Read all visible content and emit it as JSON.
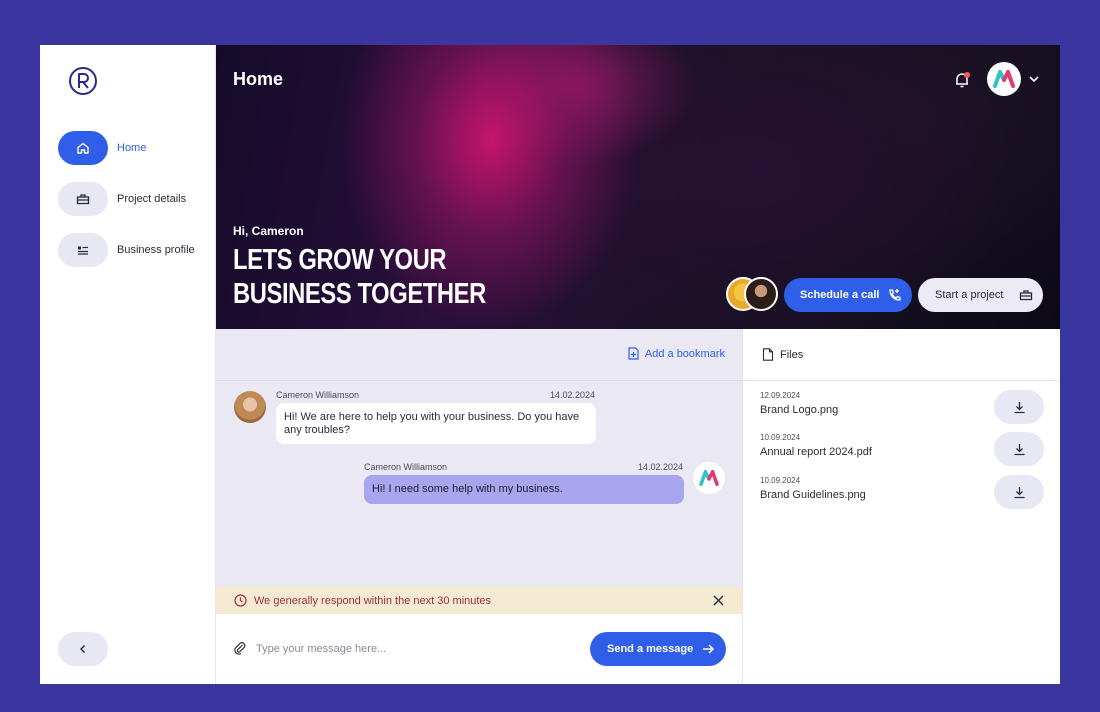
{
  "colors": {
    "accent": "#2f5fe8",
    "page_background": "#3b35a0",
    "outgoing_bubble": "#a9a5ef",
    "notice_background": "#f5ead2",
    "notice_text": "#a0303a"
  },
  "sidebar": {
    "logo_icon": "r-circle-logo-icon",
    "items": [
      {
        "label": "Home",
        "icon": "home-icon",
        "active": true
      },
      {
        "label": "Project details",
        "icon": "briefcase-icon",
        "active": false
      },
      {
        "label": "Business profile",
        "icon": "profile-card-icon",
        "active": false
      }
    ],
    "collapse_icon": "chevron-left-icon"
  },
  "header": {
    "title": "Home",
    "notification_icon": "bell-icon",
    "avatar_icon": "m-logo-icon"
  },
  "hero": {
    "greeting": "Hi, Cameron",
    "headline_line1": "LETS GROW YOUR",
    "headline_line2": "BUSINESS TOGETHER",
    "schedule_call_label": "Schedule a call",
    "start_project_label": "Start a project"
  },
  "chat": {
    "bookmark_label": "Add a bookmark",
    "messages": [
      {
        "author": "Cameron Williamson",
        "date": "14.02.2024",
        "text": "Hi!  We are here to help you with your business. Do you have any troubles?",
        "direction": "incoming"
      },
      {
        "author": "Cameron Williamson",
        "date": "14.02.2024",
        "text": "Hi!  I need some help with my business.",
        "direction": "outgoing"
      }
    ],
    "notice": "We generally respond within the next 30 minutes",
    "input_placeholder": "Type your message here...",
    "send_label": "Send a message"
  },
  "files": {
    "title": "Files",
    "items": [
      {
        "date": "12.09.2024",
        "name": "Brand Logo.png"
      },
      {
        "date": "10.09.2024",
        "name": "Annual report 2024.pdf"
      },
      {
        "date": "10.09.2024",
        "name": "Brand Guidelines.png"
      }
    ]
  }
}
